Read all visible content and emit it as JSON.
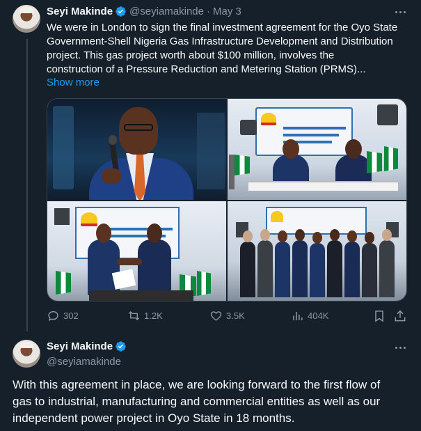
{
  "colors": {
    "background": "#15202b",
    "text": "#f7f9f9",
    "muted": "#8b98a5",
    "accent": "#1d9bf0",
    "verified": "#1d9bf0"
  },
  "tweet1": {
    "author_name": "Seyi Makinde",
    "handle": "@seyiamakinde",
    "separator": "·",
    "date": "May 3",
    "text_lines": [
      "We were in London to sign the final investment agreement for the Oyo State",
      "Government-Shell Nigeria Gas Infrastructure Development and Distribution",
      "project. This gas project worth about $100 million, involves the",
      "construction of a Pressure Reduction and Metering Station (PRMS)..."
    ],
    "show_more": "Show more",
    "photos": [
      {
        "name": "speaker-photo",
        "icon": "person-at-microphone"
      },
      {
        "name": "signing-photo",
        "icon": "two-men-signing-at-table"
      },
      {
        "name": "handshake-photo",
        "icon": "handshake"
      },
      {
        "name": "group-photo",
        "icon": "group-of-people"
      }
    ],
    "stats": {
      "replies": "302",
      "reposts": "1.2K",
      "likes": "3.5K",
      "views": "404K"
    }
  },
  "tweet2": {
    "author_name": "Seyi Makinde",
    "handle": "@seyiamakinde",
    "text_lines": [
      "With this agreement in place, we are looking forward to the first flow of",
      "gas to industrial, manufacturing and commercial entities as well as our",
      "independent power project in Oyo State in 18 months."
    ]
  }
}
